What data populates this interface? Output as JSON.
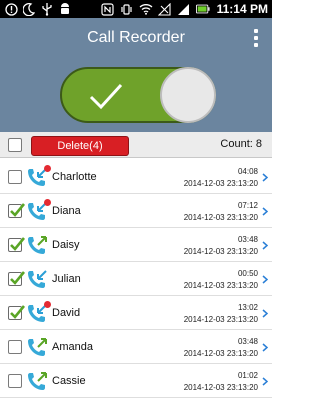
{
  "status_bar": {
    "time": "11:14 PM",
    "icons": [
      "alert-icon",
      "moon-icon",
      "usb-icon",
      "android-icon",
      "nfc-icon",
      "vibrate-icon",
      "wifi-icon",
      "signal-off-icon",
      "signal-icon",
      "battery-icon"
    ]
  },
  "app_bar": {
    "title": "Call Recorder",
    "menu_icon": "overflow-menu-icon"
  },
  "recording_toggle": {
    "state": "on",
    "color": "#6fa22a"
  },
  "action_bar": {
    "delete_label": "Delete(4)",
    "count_label": "Count: 8",
    "delete_color": "#d81f24"
  },
  "calls": [
    {
      "name": "Charlotte",
      "duration": "04:08",
      "date": "2014-12-03 23:13:20",
      "checked": false,
      "direction": "incoming",
      "new": true
    },
    {
      "name": "Diana",
      "duration": "07:12",
      "date": "2014-12-03 23:13:20",
      "checked": true,
      "direction": "incoming",
      "new": true
    },
    {
      "name": "Daisy",
      "duration": "03:48",
      "date": "2014-12-03 23:13:20",
      "checked": true,
      "direction": "outgoing",
      "new": false
    },
    {
      "name": "Julian",
      "duration": "00:50",
      "date": "2014-12-03 23:13:20",
      "checked": true,
      "direction": "incoming",
      "new": false
    },
    {
      "name": "David",
      "duration": "13:02",
      "date": "2014-12-03 23:13:20",
      "checked": true,
      "direction": "incoming",
      "new": true
    },
    {
      "name": "Amanda",
      "duration": "03:48",
      "date": "2014-12-03 23:13:20",
      "checked": false,
      "direction": "outgoing",
      "new": false
    },
    {
      "name": "Cassie",
      "duration": "01:02",
      "date": "2014-12-03 23:13:20",
      "checked": false,
      "direction": "outgoing",
      "new": false
    }
  ],
  "colors": {
    "header": "#6b859f",
    "incoming_arrow": "#2a9fd6",
    "outgoing_arrow": "#5aa526",
    "new_dot": "#e42a32"
  }
}
